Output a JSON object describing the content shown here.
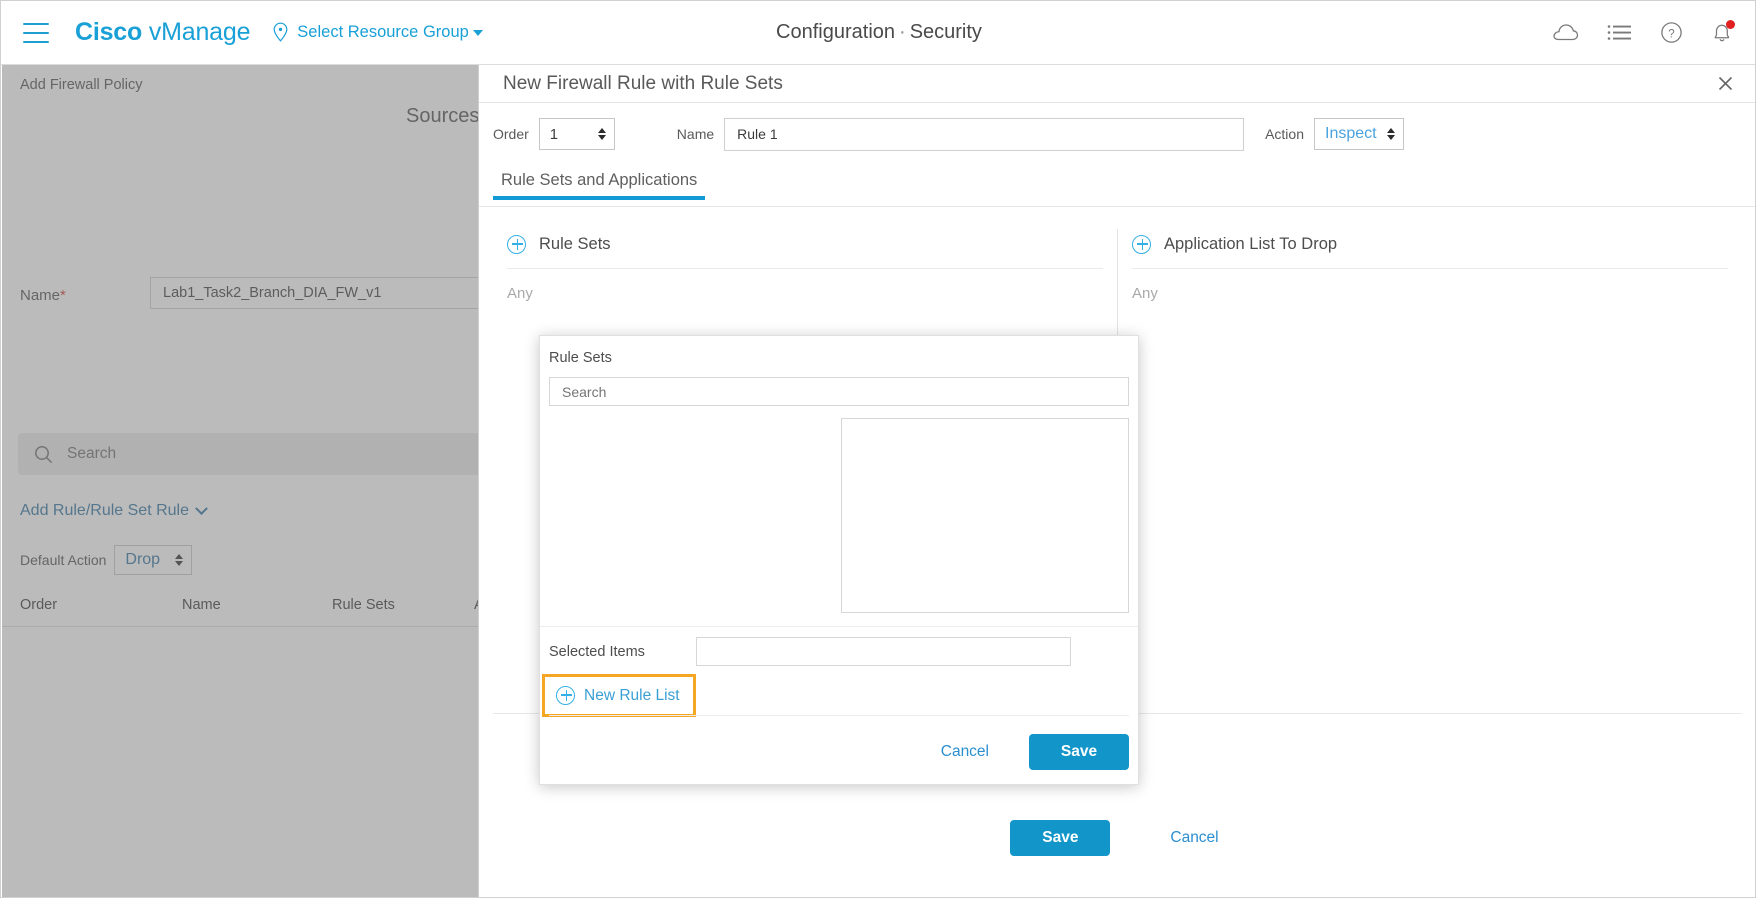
{
  "topbar": {
    "menu_icon": "hamburger-icon",
    "brand_bold": "Cisco",
    "brand_light": "vManage",
    "resource_group_label": "Select Resource Group",
    "page_title_primary": "Configuration",
    "page_title_separator": "·",
    "page_title_secondary": "Security",
    "icons": [
      {
        "name": "cloud-icon",
        "label": "Cloud"
      },
      {
        "name": "tasks-list-icon",
        "label": "Tasks"
      },
      {
        "name": "help-icon",
        "label": "Help"
      },
      {
        "name": "notifications-bell-icon",
        "label": "Alarms",
        "badge": true
      }
    ]
  },
  "background": {
    "breadcrumb": "Add Firewall Policy",
    "sources_heading": "Sources",
    "name_label": "Name",
    "name_required_marker": "*",
    "name_value": "Lab1_Task2_Branch_DIA_FW_v1",
    "search_placeholder": "Search",
    "add_rule_label": "Add Rule/Rule Set Rule",
    "default_action_label": "Default Action",
    "default_action_value": "Drop",
    "table_headers": [
      "Order",
      "Name",
      "Rule Sets",
      "A"
    ]
  },
  "panel": {
    "title": "New Firewall Rule with Rule Sets",
    "close_label": "✕",
    "order_label": "Order",
    "order_value": "1",
    "name_label": "Name",
    "name_value": "Rule 1",
    "action_label": "Action",
    "action_value": "Inspect",
    "tabs": [
      {
        "label": "Rule Sets and Applications",
        "active": true
      }
    ],
    "columns": [
      {
        "title": "Rule Sets",
        "empty_value": "Any",
        "add_icon": "plus-circle-icon"
      },
      {
        "title": "Application List To Drop",
        "empty_value": "Any",
        "add_icon": "plus-circle-icon"
      }
    ],
    "save_label": "Save",
    "cancel_label": "Cancel"
  },
  "inner_modal": {
    "label": "Rule Sets",
    "search_placeholder": "Search",
    "list_items": [],
    "selected_items_label": "Selected Items",
    "selected_items_value": "",
    "new_rule_list_label": "New Rule List",
    "new_rule_list_highlight_color": "#f5a623",
    "cancel_label": "Cancel",
    "save_label": "Save"
  },
  "colors": {
    "brand_blue": "#19a0d7",
    "accent_blue": "#1296ca",
    "link_blue": "#2a8fd0",
    "highlight_orange": "#f5a623",
    "badge_red": "#e02020"
  }
}
